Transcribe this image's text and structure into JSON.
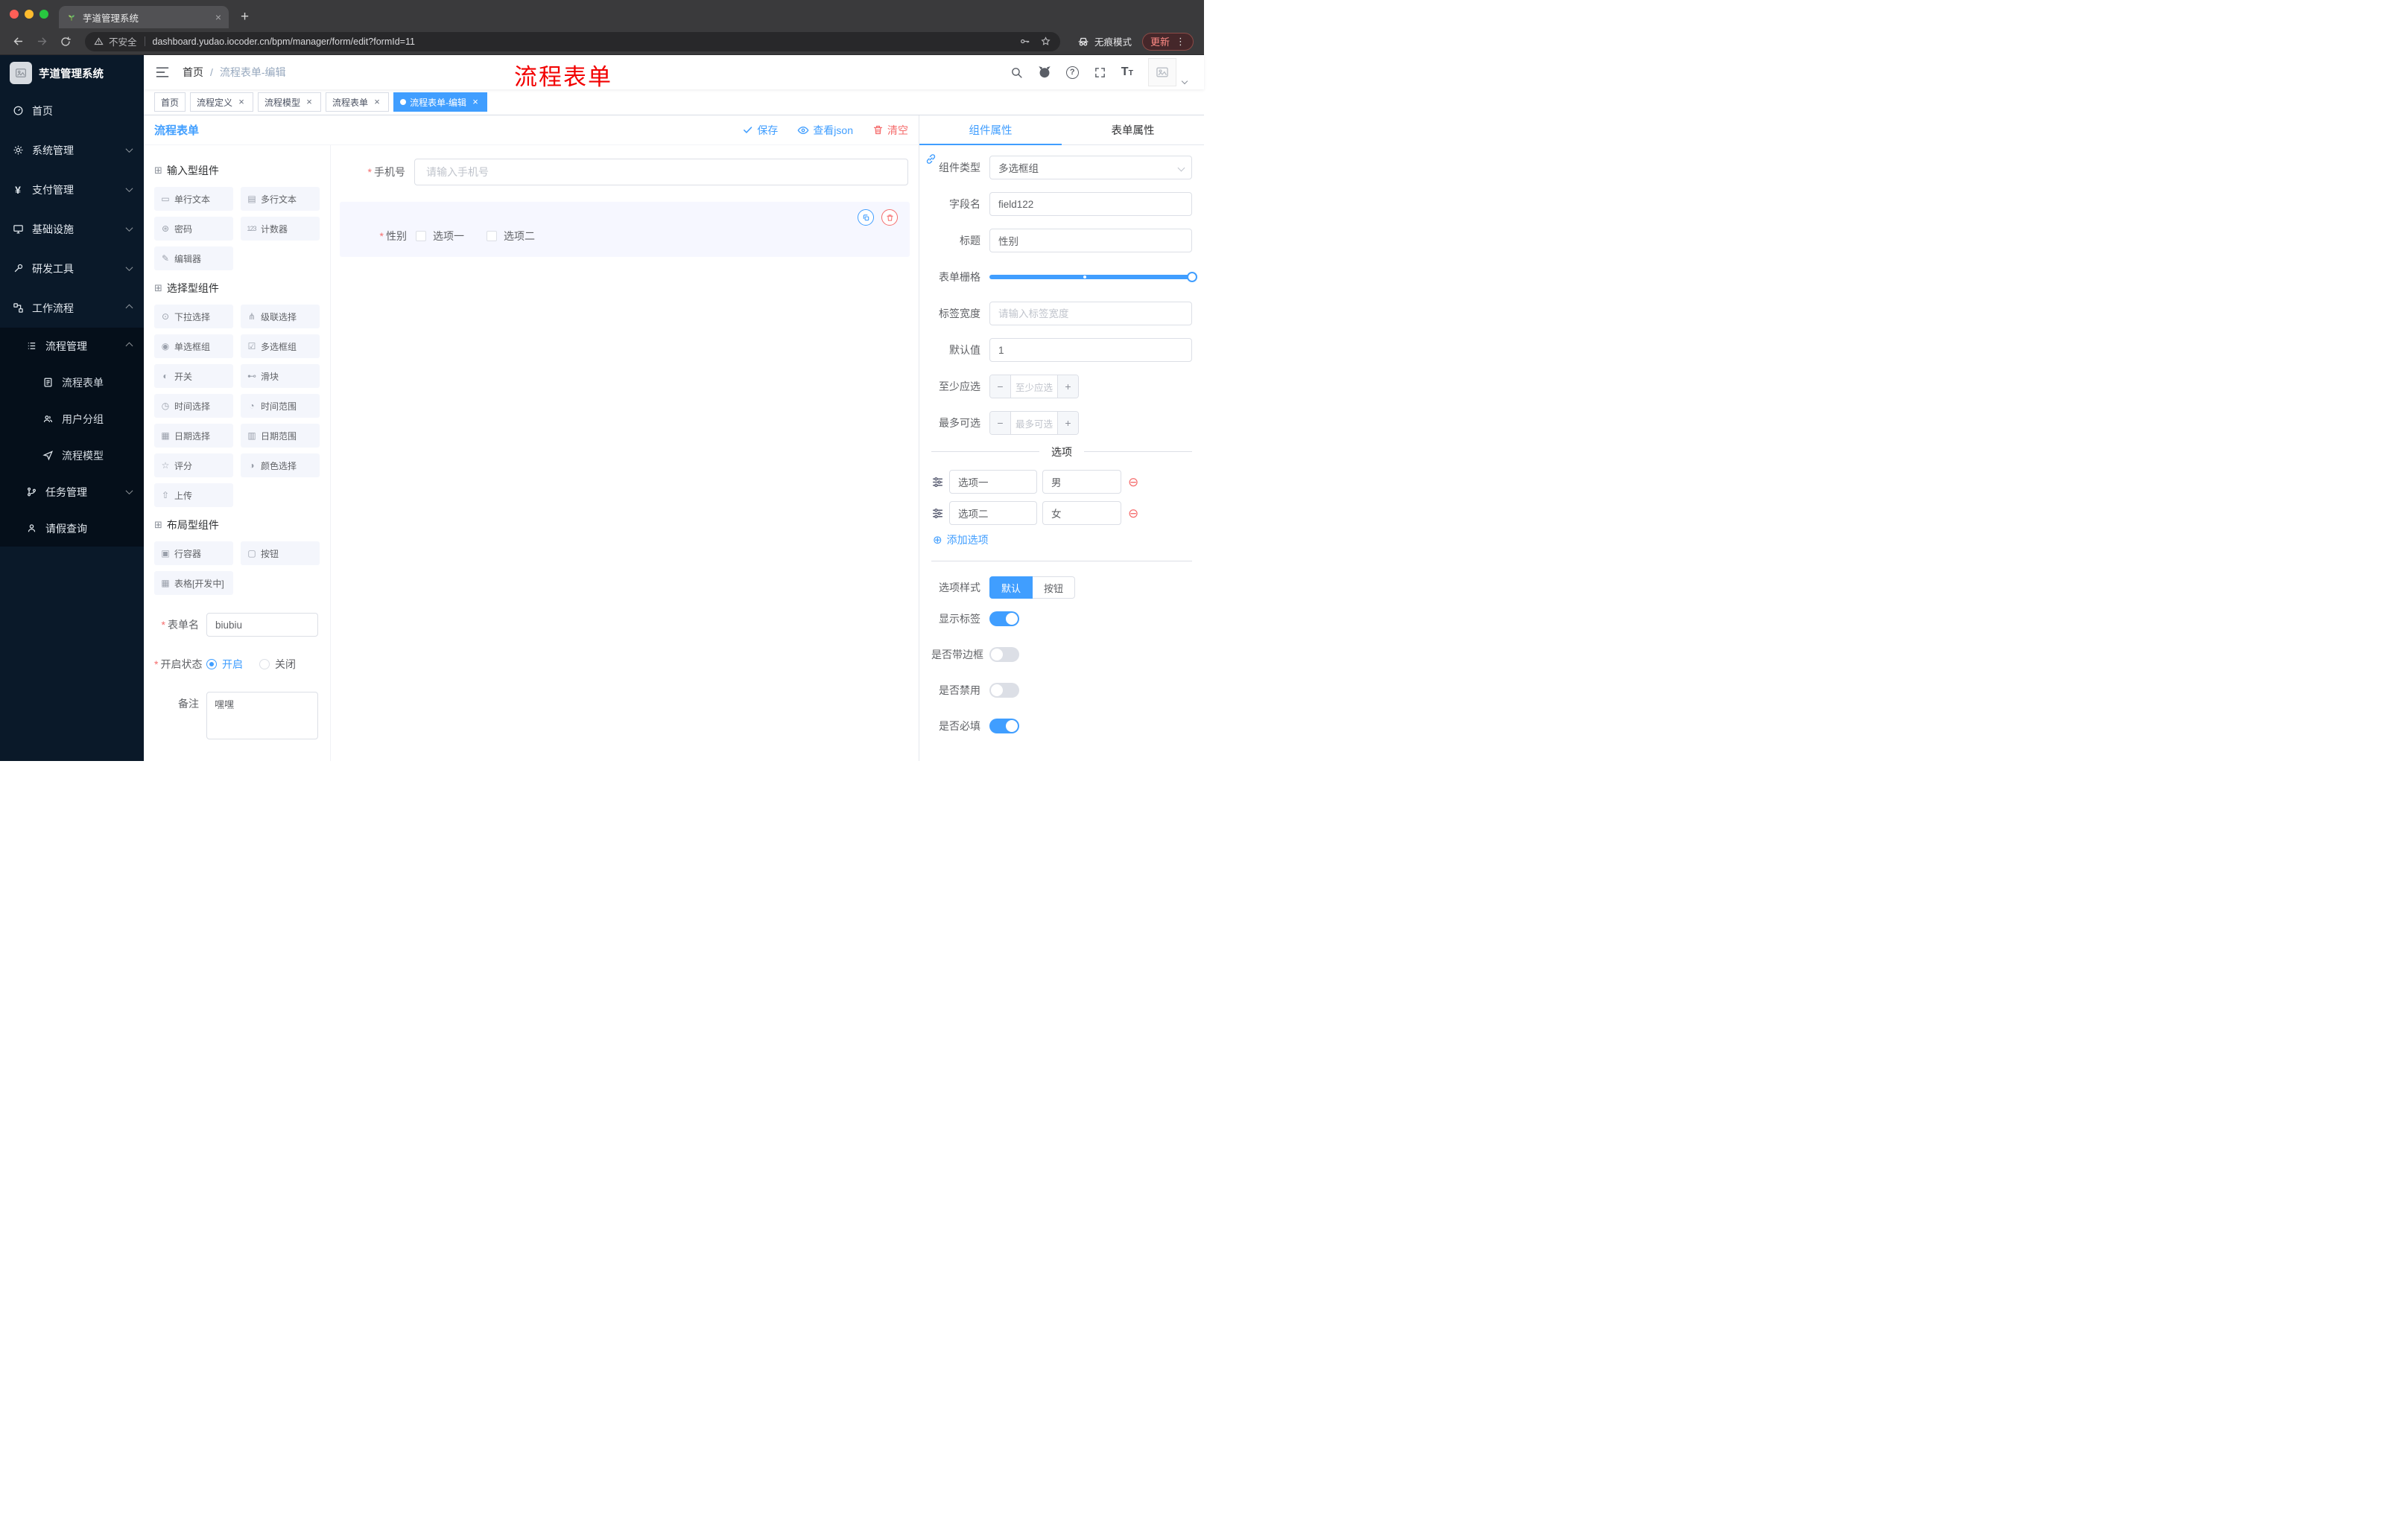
{
  "browser": {
    "tab_title": "芋道管理系统",
    "security_label": "不安全",
    "url": "dashboard.yudao.iocoder.cn/bpm/manager/form/edit?formId=11",
    "incognito_label": "无痕模式",
    "update_label": "更新"
  },
  "icons": {
    "new_tab": "+",
    "close": "×",
    "more_vertical": "⋮",
    "yen": "¥",
    "minus": "−",
    "plus": "+",
    "remove_option": "⊖",
    "add_option": "⊕",
    "question": "?",
    "font_large": "T",
    "font_small": "T",
    "section_box": "⊞"
  },
  "misc": {
    "required_mark": "*",
    "breadcrumb_separator": "/"
  },
  "sidebar": {
    "logo_title": "芋道管理系统",
    "menu": [
      {
        "label": "首页"
      },
      {
        "label": "系统管理"
      },
      {
        "label": "支付管理"
      },
      {
        "label": "基础设施"
      },
      {
        "label": "研发工具"
      },
      {
        "label": "工作流程"
      },
      {
        "label": "流程管理"
      },
      {
        "label": "流程表单"
      },
      {
        "label": "用户分组"
      },
      {
        "label": "流程模型"
      },
      {
        "label": "任务管理"
      },
      {
        "label": "请假查询"
      }
    ]
  },
  "header": {
    "breadcrumb": [
      "首页",
      "流程表单-编辑"
    ],
    "annotation": "流程表单"
  },
  "tags": [
    {
      "label": "首页"
    },
    {
      "label": "流程定义"
    },
    {
      "label": "流程模型"
    },
    {
      "label": "流程表单"
    },
    {
      "label": "流程表单-编辑"
    }
  ],
  "designer": {
    "title": "流程表单",
    "save_label": "保存",
    "view_json_label": "查看json",
    "clear_label": "清空"
  },
  "palette": {
    "sections": [
      {
        "title": "输入型组件",
        "items": [
          {
            "label": "单行文本",
            "glyph": "▭"
          },
          {
            "label": "多行文本",
            "glyph": "▤"
          },
          {
            "label": "密码",
            "glyph": "⊛"
          },
          {
            "label": "计数器",
            "glyph": "123"
          },
          {
            "label": "编辑器",
            "glyph": "✎"
          }
        ]
      },
      {
        "title": "选择型组件",
        "items": [
          {
            "label": "下拉选择",
            "glyph": "⊙"
          },
          {
            "label": "级联选择",
            "glyph": "⋔"
          },
          {
            "label": "单选框组",
            "glyph": "◉"
          },
          {
            "label": "多选框组",
            "glyph": "☑"
          },
          {
            "label": "开关",
            "glyph": "◐"
          },
          {
            "label": "滑块",
            "glyph": "⊷"
          },
          {
            "label": "时间选择",
            "glyph": "◷"
          },
          {
            "label": "时间范围",
            "glyph": "◔"
          },
          {
            "label": "日期选择",
            "glyph": "▦"
          },
          {
            "label": "日期范围",
            "glyph": "▥"
          },
          {
            "label": "评分",
            "glyph": "☆"
          },
          {
            "label": "颜色选择",
            "glyph": "◑"
          },
          {
            "label": "上传",
            "glyph": "⇧"
          }
        ]
      },
      {
        "title": "布局型组件",
        "items": [
          {
            "label": "行容器",
            "glyph": "▣"
          },
          {
            "label": "按钮",
            "glyph": "▢"
          },
          {
            "label": "表格[开发中]",
            "glyph": "▦"
          }
        ]
      }
    ],
    "form_settings": {
      "name_label": "表单名",
      "name_value": "biubiu",
      "status_label": "开启状态",
      "status_on": "开启",
      "status_off": "关闭",
      "remark_label": "备注",
      "remark_value": "嘿嘿"
    }
  },
  "canvas": {
    "phone": {
      "label": "手机号",
      "placeholder": "请输入手机号"
    },
    "gender": {
      "label": "性别",
      "options": [
        "选项一",
        "选项二"
      ]
    }
  },
  "props": {
    "tab_component": "组件属性",
    "tab_form": "表单属性",
    "component_type_label": "组件类型",
    "component_type_value": "多选框组",
    "field_name_label": "字段名",
    "field_name_value": "field122",
    "title_label": "标题",
    "title_value": "性别",
    "grid_label": "表单栅格",
    "label_width_label": "标签宽度",
    "label_width_placeholder": "请输入标签宽度",
    "default_label": "默认值",
    "default_value": "1",
    "min_label": "至少应选",
    "min_placeholder": "至少应选",
    "max_label": "最多可选",
    "max_placeholder": "最多可选",
    "options_title": "选项",
    "options": [
      {
        "label": "选项一",
        "value": "男"
      },
      {
        "label": "选项二",
        "value": "女"
      }
    ],
    "add_option_label": "添加选项",
    "style_label": "选项样式",
    "style_default": "默认",
    "style_button": "按钮",
    "show_label_label": "显示标签",
    "border_label": "是否带边框",
    "disabled_label": "是否禁用",
    "required_label": "是否必填"
  }
}
